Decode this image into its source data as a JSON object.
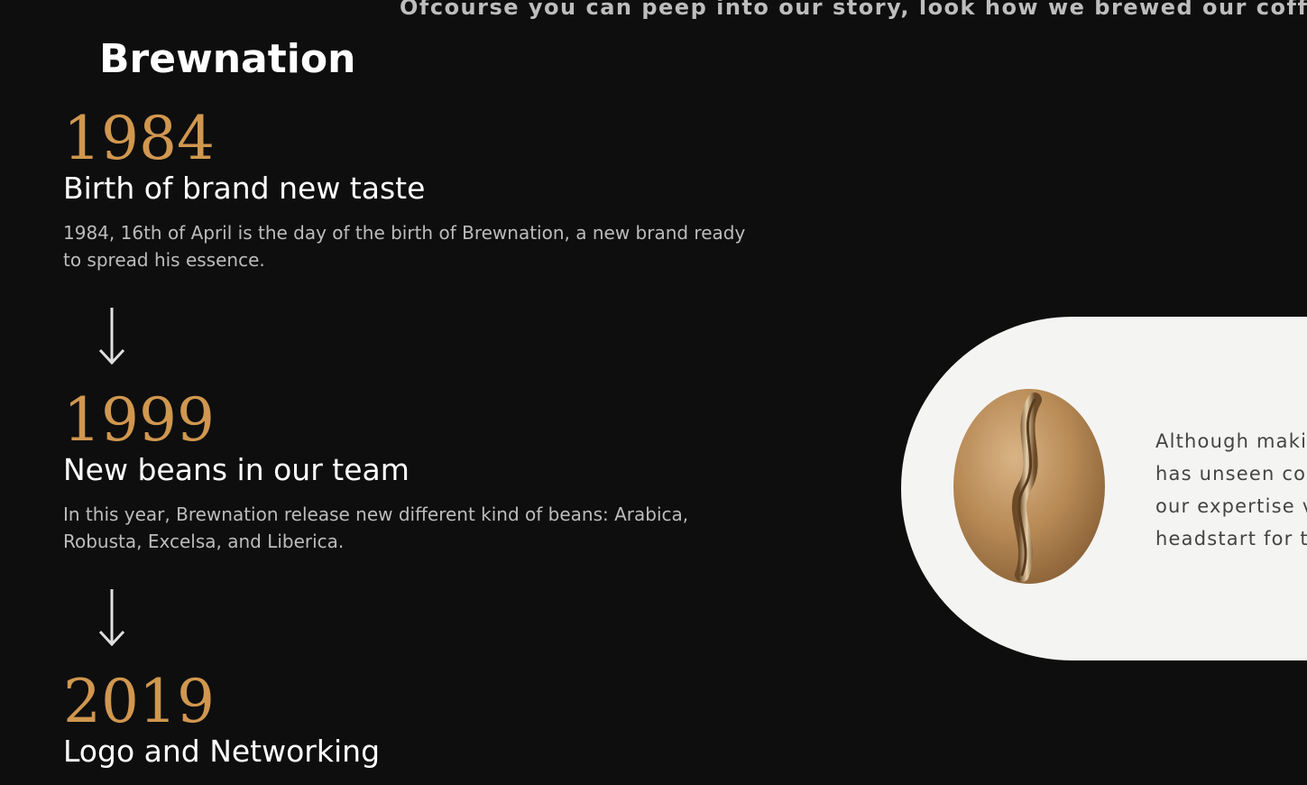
{
  "header": {
    "tagline": "Ofcourse you can peep into our story, look how we brewed our coffee",
    "brand": "Brewnation"
  },
  "timeline": [
    {
      "year": "1984",
      "title": "Birth of brand new taste",
      "description": "1984, 16th of April is the day of the birth of Brewnation, a new brand ready to spread his essence."
    },
    {
      "year": "1999",
      "title": "New beans in our team",
      "description": "In this year, Brewnation release new different kind of beans: Arabica, Robusta, Excelsa, and Liberica."
    },
    {
      "year": "2019",
      "title": "Logo and Networking",
      "description": ""
    }
  ],
  "card": {
    "image": "coffee-bean",
    "lines": [
      "Although maki",
      "has unseen co",
      "our expertise v",
      "headstart for t"
    ]
  },
  "colors": {
    "background": "#0e0e0e",
    "accent": "#d0974f",
    "card": "#f4f4f2"
  }
}
